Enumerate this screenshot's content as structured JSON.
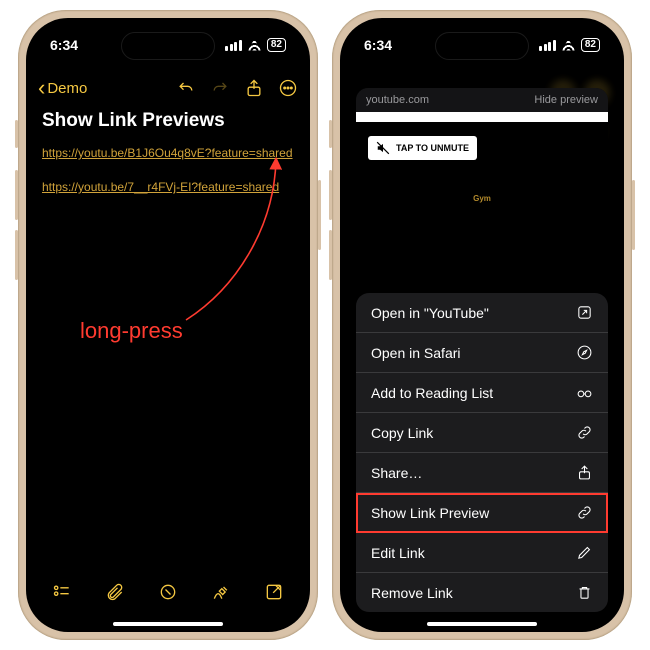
{
  "status": {
    "time": "6:34",
    "battery": "82"
  },
  "left": {
    "nav": {
      "back": "Demo"
    },
    "title": "Show Link Previews",
    "links": [
      "https://youtu.be/B1J6Ou4q8vE?feature=shared",
      "https://youtu.be/7__r4FVj-EI?feature=shared"
    ],
    "annotation": "long-press"
  },
  "right": {
    "preview": {
      "domain": "youtube.com",
      "hide": "Hide preview",
      "unmute": "TAP TO UNMUTE",
      "videoLabel": "Gym"
    },
    "menu": [
      {
        "label": "Open in \"YouTube\"",
        "icon": "open-external"
      },
      {
        "label": "Open in Safari",
        "icon": "compass"
      },
      {
        "label": "Add to Reading List",
        "icon": "glasses"
      },
      {
        "label": "Copy Link",
        "icon": "link"
      },
      {
        "label": "Share…",
        "icon": "share"
      },
      {
        "label": "Show Link Preview",
        "icon": "link",
        "highlight": true
      },
      {
        "label": "Edit Link",
        "icon": "pencil"
      },
      {
        "label": "Remove Link",
        "icon": "trash"
      }
    ]
  }
}
